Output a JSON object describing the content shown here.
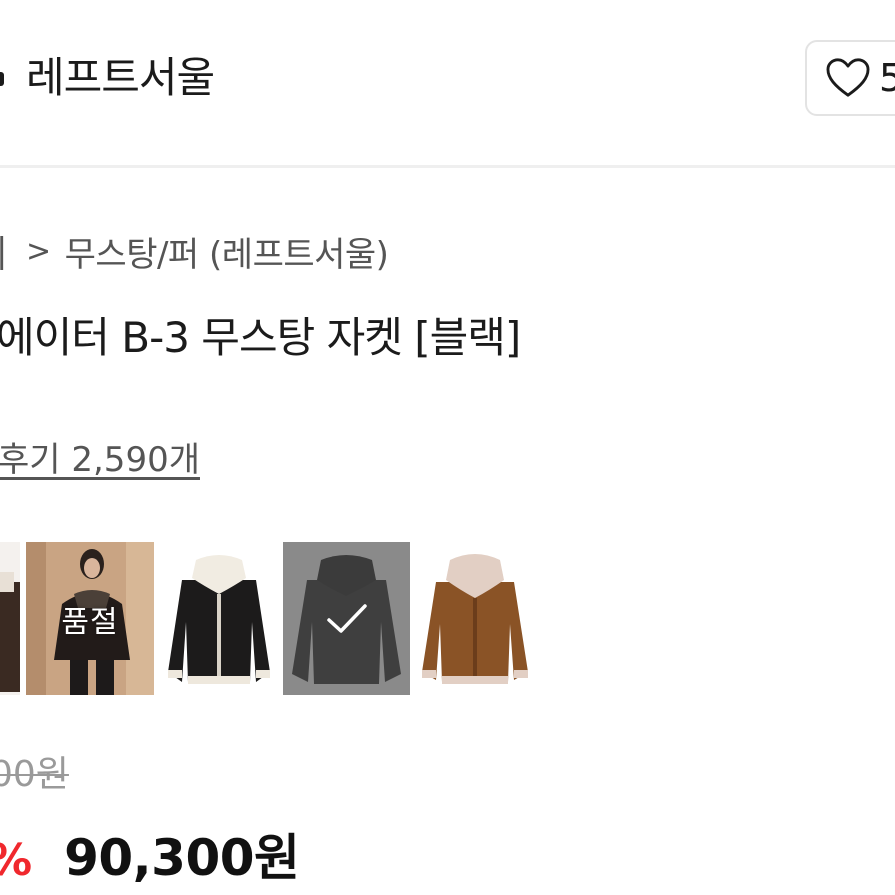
{
  "header": {
    "brand_name": "레프트서울",
    "like_count": "5"
  },
  "breadcrumb": {
    "prev": "|",
    "separator": ">",
    "current": "무스탕/퍼 (레프트서울)"
  },
  "product": {
    "title": "에이터 B-3 무스탕 자켓 [블랙]",
    "review_link": "후기 2,590개"
  },
  "swatches": [
    {
      "name": "partial-jacket",
      "soldout": false,
      "selected": false
    },
    {
      "name": "model-photo",
      "soldout": true,
      "soldout_label": "품절",
      "selected": false
    },
    {
      "name": "black-white-collar",
      "soldout": false,
      "selected": false
    },
    {
      "name": "black",
      "soldout": false,
      "selected": true
    },
    {
      "name": "brown",
      "soldout": false,
      "selected": false
    }
  ],
  "price": {
    "original": "00원",
    "discount": "%",
    "sale": "90,300원"
  },
  "colors": {
    "discount_red": "#f0282d",
    "text": "#1b1b1b",
    "muted": "#555555"
  }
}
